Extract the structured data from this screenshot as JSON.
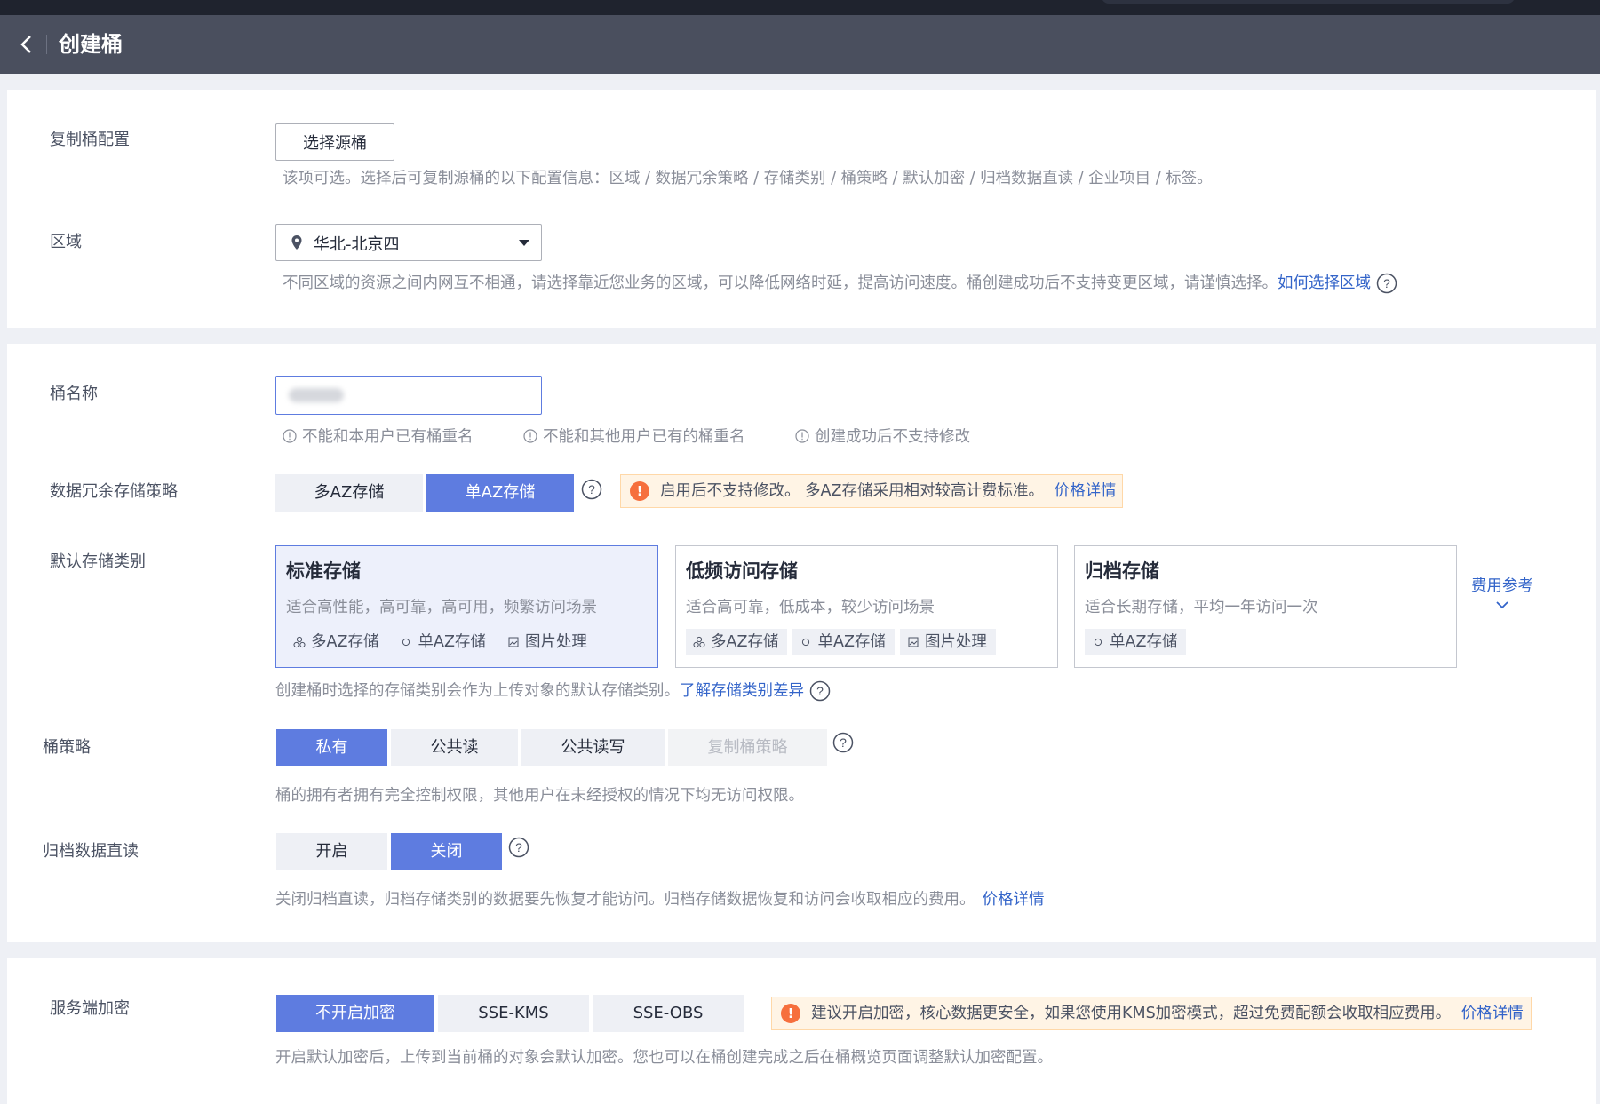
{
  "header": {
    "title": "创建桶"
  },
  "replicate": {
    "label": "复制桶配置",
    "button": "选择源桶",
    "hint": "该项可选。选择后可复制源桶的以下配置信息：区域 / 数据冗余策略 / 存储类别 / 桶策略 / 默认加密 / 归档数据直读 / 企业项目 / 标签。"
  },
  "region": {
    "label": "区域",
    "value": "华北-北京四",
    "hint": "不同区域的资源之间内网互不相通，请选择靠近您业务的区域，可以降低网络时延，提高访问速度。桶创建成功后不支持变更区域，请谨慎选择。",
    "link": "如何选择区域"
  },
  "bucket_name": {
    "label": "桶名称",
    "value": "",
    "rules": [
      "不能和本用户已有桶重名",
      "不能和其他用户已有的桶重名",
      "创建成功后不支持修改"
    ]
  },
  "redundancy": {
    "label": "数据冗余存储策略",
    "options": [
      "多AZ存储",
      "单AZ存储"
    ],
    "selected": "单AZ存储",
    "warning": "启用后不支持修改。 多AZ存储采用相对较高计费标准。",
    "warning_link": "价格详情"
  },
  "storage_class": {
    "label": "默认存储类别",
    "cards": [
      {
        "title": "标准存储",
        "desc": "适合高性能，高可靠，高可用，频繁访问场景",
        "tags": [
          "多AZ存储",
          "单AZ存储",
          "图片处理"
        ]
      },
      {
        "title": "低频访问存储",
        "desc": "适合高可靠，低成本，较少访问场景",
        "tags": [
          "多AZ存储",
          "单AZ存储",
          "图片处理"
        ]
      },
      {
        "title": "归档存储",
        "desc": "适合长期存储，平均一年访问一次",
        "tags": [
          "单AZ存储"
        ]
      }
    ],
    "selected": "标准存储",
    "fee_link": "费用参考",
    "hint": "创建桶时选择的存储类别会作为上传对象的默认存储类别。",
    "hint_link": "了解存储类别差异"
  },
  "policy": {
    "label": "桶策略",
    "options": [
      "私有",
      "公共读",
      "公共读写",
      "复制桶策略"
    ],
    "selected": "私有",
    "hint": "桶的拥有者拥有完全控制权限，其他用户在未经授权的情况下均无访问权限。"
  },
  "archive_read": {
    "label": "归档数据直读",
    "options": [
      "开启",
      "关闭"
    ],
    "selected": "关闭",
    "hint": "关闭归档直读，归档存储类别的数据要先恢复才能访问。归档存储数据恢复和访问会收取相应的费用。",
    "hint_link": "价格详情"
  },
  "encryption": {
    "label": "服务端加密",
    "options": [
      "不开启加密",
      "SSE-KMS",
      "SSE-OBS"
    ],
    "selected": "不开启加密",
    "warning": "建议开启加密，核心数据更安全，如果您使用KMS加密模式，超过免费配额会收取相应费用。",
    "warning_link": "价格详情",
    "hint": "开启默认加密后，上传到当前桶的对象会默认加密。您也可以在桶创建完成之后在桶概览页面调整默认加密配置。"
  },
  "colors": {
    "primary": "#5e7ce0",
    "link": "#3364c9",
    "warning": "#f66f3d",
    "header_bg": "#4a4f5e"
  }
}
